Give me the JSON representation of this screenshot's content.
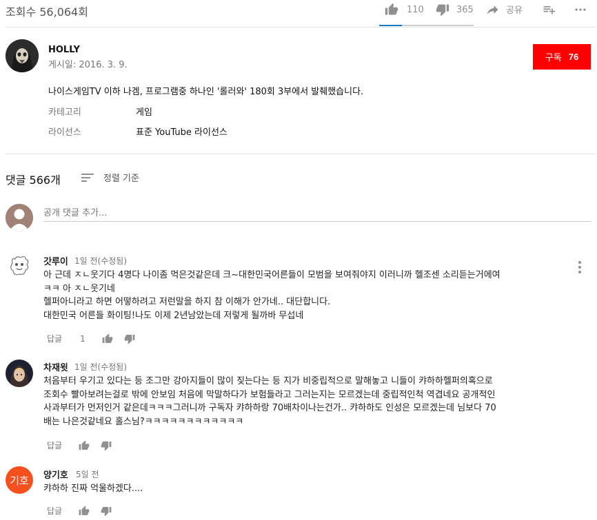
{
  "video": {
    "views": "조회수 56,064회",
    "likes": "110",
    "dislikes": "365",
    "share_label": "공유",
    "add_to_label": "",
    "more_label": ""
  },
  "channel": {
    "name": "HOLLY",
    "published": "게시일: 2016. 3. 9.",
    "subscribe_label": "구독",
    "subscriber_count": "76"
  },
  "description": {
    "text": "나이스게임TV 이하 나겜, 프로그램중 하나인 '롤러와' 180회 3부에서 발췌했습니다.",
    "category_label": "카테고리",
    "category_value": "게임",
    "license_label": "라이선스",
    "license_value": "표준 YouTube 라이선스"
  },
  "comments_header": {
    "count": "댓글 566개",
    "sort_label": "정렬 기준"
  },
  "add_comment": {
    "placeholder": "공개 댓글 추가..."
  },
  "comments": [
    {
      "author": "갓루이",
      "time": "1일 전(수정됨)",
      "text": "아 근데 ㅈㄴ웃기다 4명다 나이좀 먹은것같은데 크~대한민국어른들이 모범을 보여줘야지 이러니까 헬조센 소리듣는거에여\nㅋㅋ 아 ㅈㄴ웃기네\n헬퍼아니라고 하면 어떻하려고 저런말을 하지 참 이해가 안가네.. 대단합니다.\n대한민국 어른들 화이팅!나도 이제 2년남았는데 저렇게 될까바 무섭네",
      "reply_label": "답글",
      "likes": "1"
    },
    {
      "author": "차재윗",
      "time": "1일 전(수정됨)",
      "text": "처음부터 우기고 있다는 등 조그만 강아지들이 많이 짖는다는 등 지가 비중립적으로 말해놓고 니들이 캬하하헬퍼의혹으로\n조회수 빨아보려는걸로 밖에 안보임 처음에 막말하다가 보험들라고 그러는지는 모르겠는데 중립적인척 역겹네요 공개적인\n사과부터가 먼저인거 같은데ㅋㅋㅋ그러니까 구독자 캬하하랑 70배차이나는건가.. 캬하하도 인성은 모르겠는데 님보다 70\n배는 나은것같네요 홀스님?ㅋㅋㅋㅋㅋㅋㅋㅋㅋㅋㅋㅋ",
      "reply_label": "답글",
      "likes": ""
    },
    {
      "author": "양기호",
      "avatar_text": "기호",
      "time": "5일 전",
      "text": "캬하하 진짜 억울하겠다....",
      "reply_label": "답글",
      "likes": ""
    }
  ],
  "colors": {
    "subscribe_bg": "#ff0000",
    "like_accent": "#167ac6",
    "avatar_orange": "#f4511e"
  }
}
